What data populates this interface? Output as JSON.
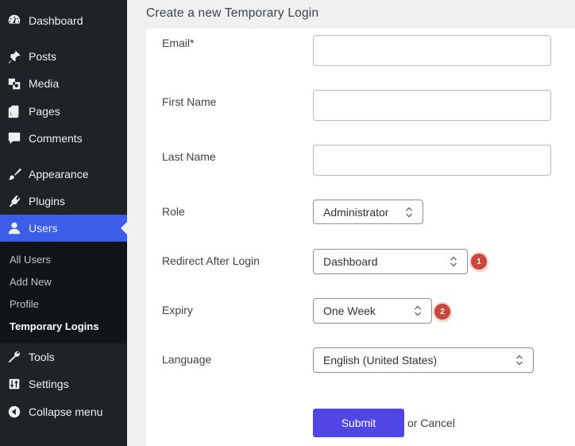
{
  "sidebar": {
    "items": [
      {
        "label": "Dashboard",
        "icon": "dashboard-icon"
      },
      {
        "label": "Posts",
        "icon": "pin-icon"
      },
      {
        "label": "Media",
        "icon": "media-icon"
      },
      {
        "label": "Pages",
        "icon": "pages-icon"
      },
      {
        "label": "Comments",
        "icon": "comment-icon"
      },
      {
        "label": "Appearance",
        "icon": "brush-icon"
      },
      {
        "label": "Plugins",
        "icon": "plugin-icon"
      },
      {
        "label": "Users",
        "icon": "user-icon"
      },
      {
        "label": "Tools",
        "icon": "wrench-icon"
      },
      {
        "label": "Settings",
        "icon": "sliders-icon"
      },
      {
        "label": "Collapse menu",
        "icon": "collapse-icon"
      }
    ],
    "submenu": [
      "All Users",
      "Add New",
      "Profile",
      "Temporary Logins"
    ],
    "active": "Users",
    "current_submenu": "Temporary Logins"
  },
  "page": {
    "title": "Create a new Temporary Login"
  },
  "form": {
    "email_label": "Email*",
    "email_value": "",
    "first_name_label": "First Name",
    "first_name_value": "",
    "last_name_label": "Last Name",
    "last_name_value": "",
    "role_label": "Role",
    "role_value": "Administrator",
    "redirect_label": "Redirect After Login",
    "redirect_value": "Dashboard",
    "redirect_badge": "1",
    "expiry_label": "Expiry",
    "expiry_value": "One Week",
    "expiry_badge": "2",
    "language_label": "Language",
    "language_value": "English (United States)",
    "submit_label": "Submit",
    "or_text": "or",
    "cancel_label": "Cancel"
  },
  "colors": {
    "sidebar_bg": "#1d2327",
    "active_bg": "#3b5de8",
    "submit_bg": "#5046e6",
    "badge_bg": "#c9483d"
  }
}
